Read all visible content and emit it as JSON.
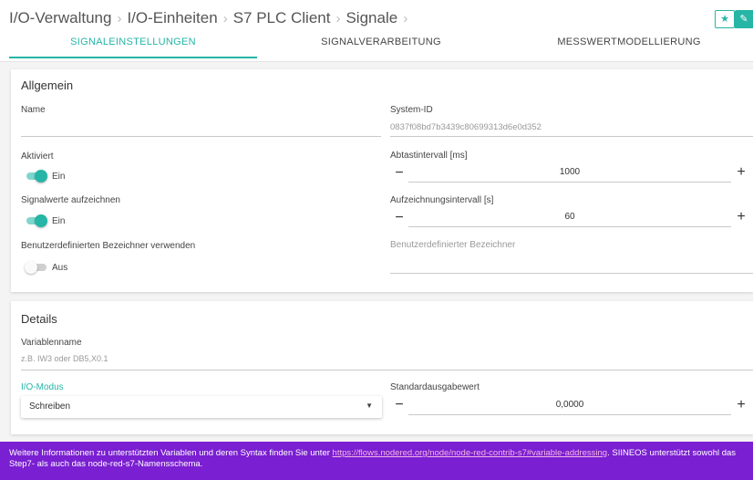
{
  "breadcrumb": {
    "items": [
      "I/O-Verwaltung",
      "I/O-Einheiten",
      "S7 PLC Client",
      "Signale"
    ],
    "separator": "›"
  },
  "header_buttons": {
    "star_icon": "star-icon",
    "edit_icon": "pencil-icon"
  },
  "tabs": [
    {
      "label": "SIGNALEINSTELLUNGEN",
      "active": true
    },
    {
      "label": "SIGNALVERARBEITUNG",
      "active": false
    },
    {
      "label": "MESSWERTMODELLIERUNG",
      "active": false
    }
  ],
  "general": {
    "title": "Allgemein",
    "name": {
      "label": "Name",
      "value": ""
    },
    "system_id": {
      "label": "System-ID",
      "value": "0837f08bd7b3439c80699313d6e0d352"
    },
    "enabled": {
      "label": "Aktiviert",
      "on": true,
      "state_text": "Ein"
    },
    "record": {
      "label": "Signalwerte aufzeichnen",
      "on": true,
      "state_text": "Ein"
    },
    "custom_id_toggle": {
      "label": "Benutzerdefinierten Bezeichner verwenden",
      "on": false,
      "state_text": "Aus"
    },
    "sample_interval": {
      "label": "Abtastintervall [ms]",
      "value": "1000",
      "minus": "−",
      "plus": "+"
    },
    "record_interval": {
      "label": "Aufzeichnungsintervall [s]",
      "value": "60",
      "minus": "−",
      "plus": "+"
    },
    "custom_id": {
      "placeholder": "Benutzerdefinierter Bezeichner"
    }
  },
  "details": {
    "title": "Details",
    "variable": {
      "label": "Variablenname",
      "placeholder": "z.B. IW3 oder DB5,X0.1"
    },
    "io_mode": {
      "label": "I/O-Modus",
      "value": "Schreiben",
      "arrow": "▼"
    },
    "default_output": {
      "label": "Standardausgabewert",
      "value": "0,0000",
      "minus": "−",
      "plus": "+"
    }
  },
  "info": {
    "text_before": "Weitere Informationen zu unterstützten Variablen und deren Syntax finden Sie unter ",
    "link": "https://flows.nodered.org/node/node-red-contrib-s7#variable-addressing",
    "text_after": ". SIINEOS unterstützt sowohl das Step7- als auch das node-red-s7-Namensschema."
  },
  "colors": {
    "accent": "#26b5a6",
    "info_bg": "#7a1fd1",
    "link": "#f5b5e6"
  }
}
